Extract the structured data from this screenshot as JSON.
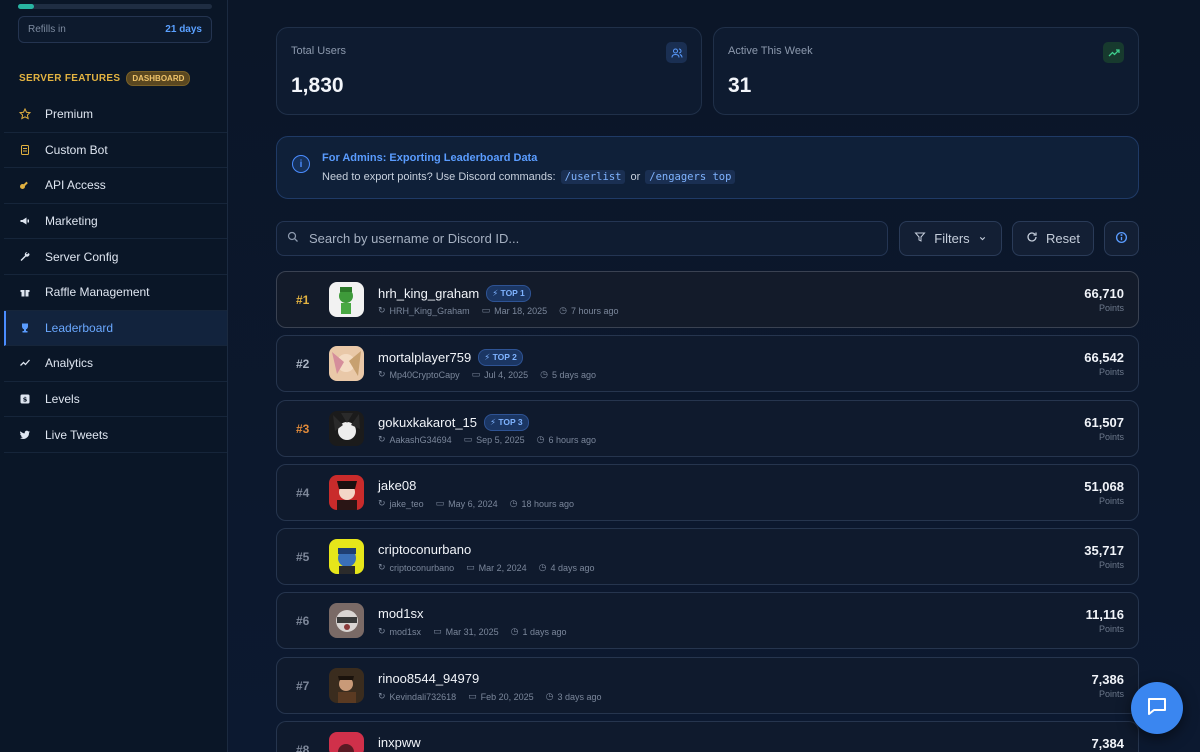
{
  "sidebar": {
    "refill": {
      "label": "Refills in",
      "value": "21 days",
      "progress_fraction": 0.08
    },
    "section_title": "SERVER FEATURES",
    "section_badge": "DASHBOARD",
    "items": [
      {
        "label": "Premium",
        "icon": "star-icon"
      },
      {
        "label": "Custom Bot",
        "icon": "bot-icon"
      },
      {
        "label": "API Access",
        "icon": "key-icon"
      },
      {
        "label": "Marketing",
        "icon": "megaphone-icon"
      },
      {
        "label": "Server Config",
        "icon": "wrench-icon"
      },
      {
        "label": "Raffle Management",
        "icon": "gift-icon"
      },
      {
        "label": "Leaderboard",
        "icon": "trophy-icon",
        "active": true
      },
      {
        "label": "Analytics",
        "icon": "chart-line-icon"
      },
      {
        "label": "Levels",
        "icon": "levels-icon"
      },
      {
        "label": "Live Tweets",
        "icon": "twitter-icon"
      }
    ]
  },
  "stats": [
    {
      "label": "Total Users",
      "value": "1,830",
      "icon": "users-icon"
    },
    {
      "label": "Active This Week",
      "value": "31",
      "icon": "trending-up-icon"
    }
  ],
  "admin_notice": {
    "title": "For Admins: Exporting Leaderboard Data",
    "text": "Need to export points? Use Discord commands:",
    "cmd1": "/userlist",
    "or": "or",
    "cmd2": "/engagers top"
  },
  "toolbar": {
    "search_placeholder": "Search by username or Discord ID...",
    "filters_label": "Filters",
    "reset_label": "Reset"
  },
  "leaderboard": [
    {
      "rank": "#1",
      "name": "hrh_king_graham",
      "badge": "TOP 1",
      "handle": "HRH_King_Graham",
      "date": "Mar 18, 2025",
      "ago": "7 hours ago",
      "points": "66,710",
      "points_label": "Points"
    },
    {
      "rank": "#2",
      "name": "mortalplayer759",
      "badge": "TOP 2",
      "handle": "Mp40CryptoCapy",
      "date": "Jul 4, 2025",
      "ago": "5 days ago",
      "points": "66,542",
      "points_label": "Points"
    },
    {
      "rank": "#3",
      "name": "gokuxkakarot_15",
      "badge": "TOP 3",
      "handle": "AakashG34694",
      "date": "Sep 5, 2025",
      "ago": "6 hours ago",
      "points": "61,507",
      "points_label": "Points"
    },
    {
      "rank": "#4",
      "name": "jake08",
      "badge": "",
      "handle": "jake_teo",
      "date": "May 6, 2024",
      "ago": "18 hours ago",
      "points": "51,068",
      "points_label": "Points"
    },
    {
      "rank": "#5",
      "name": "criptoconurbano",
      "badge": "",
      "handle": "criptoconurbano",
      "date": "Mar 2, 2024",
      "ago": "4 days ago",
      "points": "35,717",
      "points_label": "Points"
    },
    {
      "rank": "#6",
      "name": "mod1sx",
      "badge": "",
      "handle": "mod1sx",
      "date": "Mar 31, 2025",
      "ago": "1 days ago",
      "points": "11,116",
      "points_label": "Points"
    },
    {
      "rank": "#7",
      "name": "rinoo8544_94979",
      "badge": "",
      "handle": "Kevindali732618",
      "date": "Feb 20, 2025",
      "ago": "3 days ago",
      "points": "7,386",
      "points_label": "Points"
    },
    {
      "rank": "#8",
      "name": "inxpww",
      "badge": "",
      "handle": "",
      "date": "",
      "ago": "",
      "points": "7,384",
      "points_label": ""
    }
  ],
  "colors": {
    "rank1": "#e3b341",
    "rank2": "#aab4c3",
    "rank3": "#e08a3a",
    "accent": "#4a8cff"
  }
}
